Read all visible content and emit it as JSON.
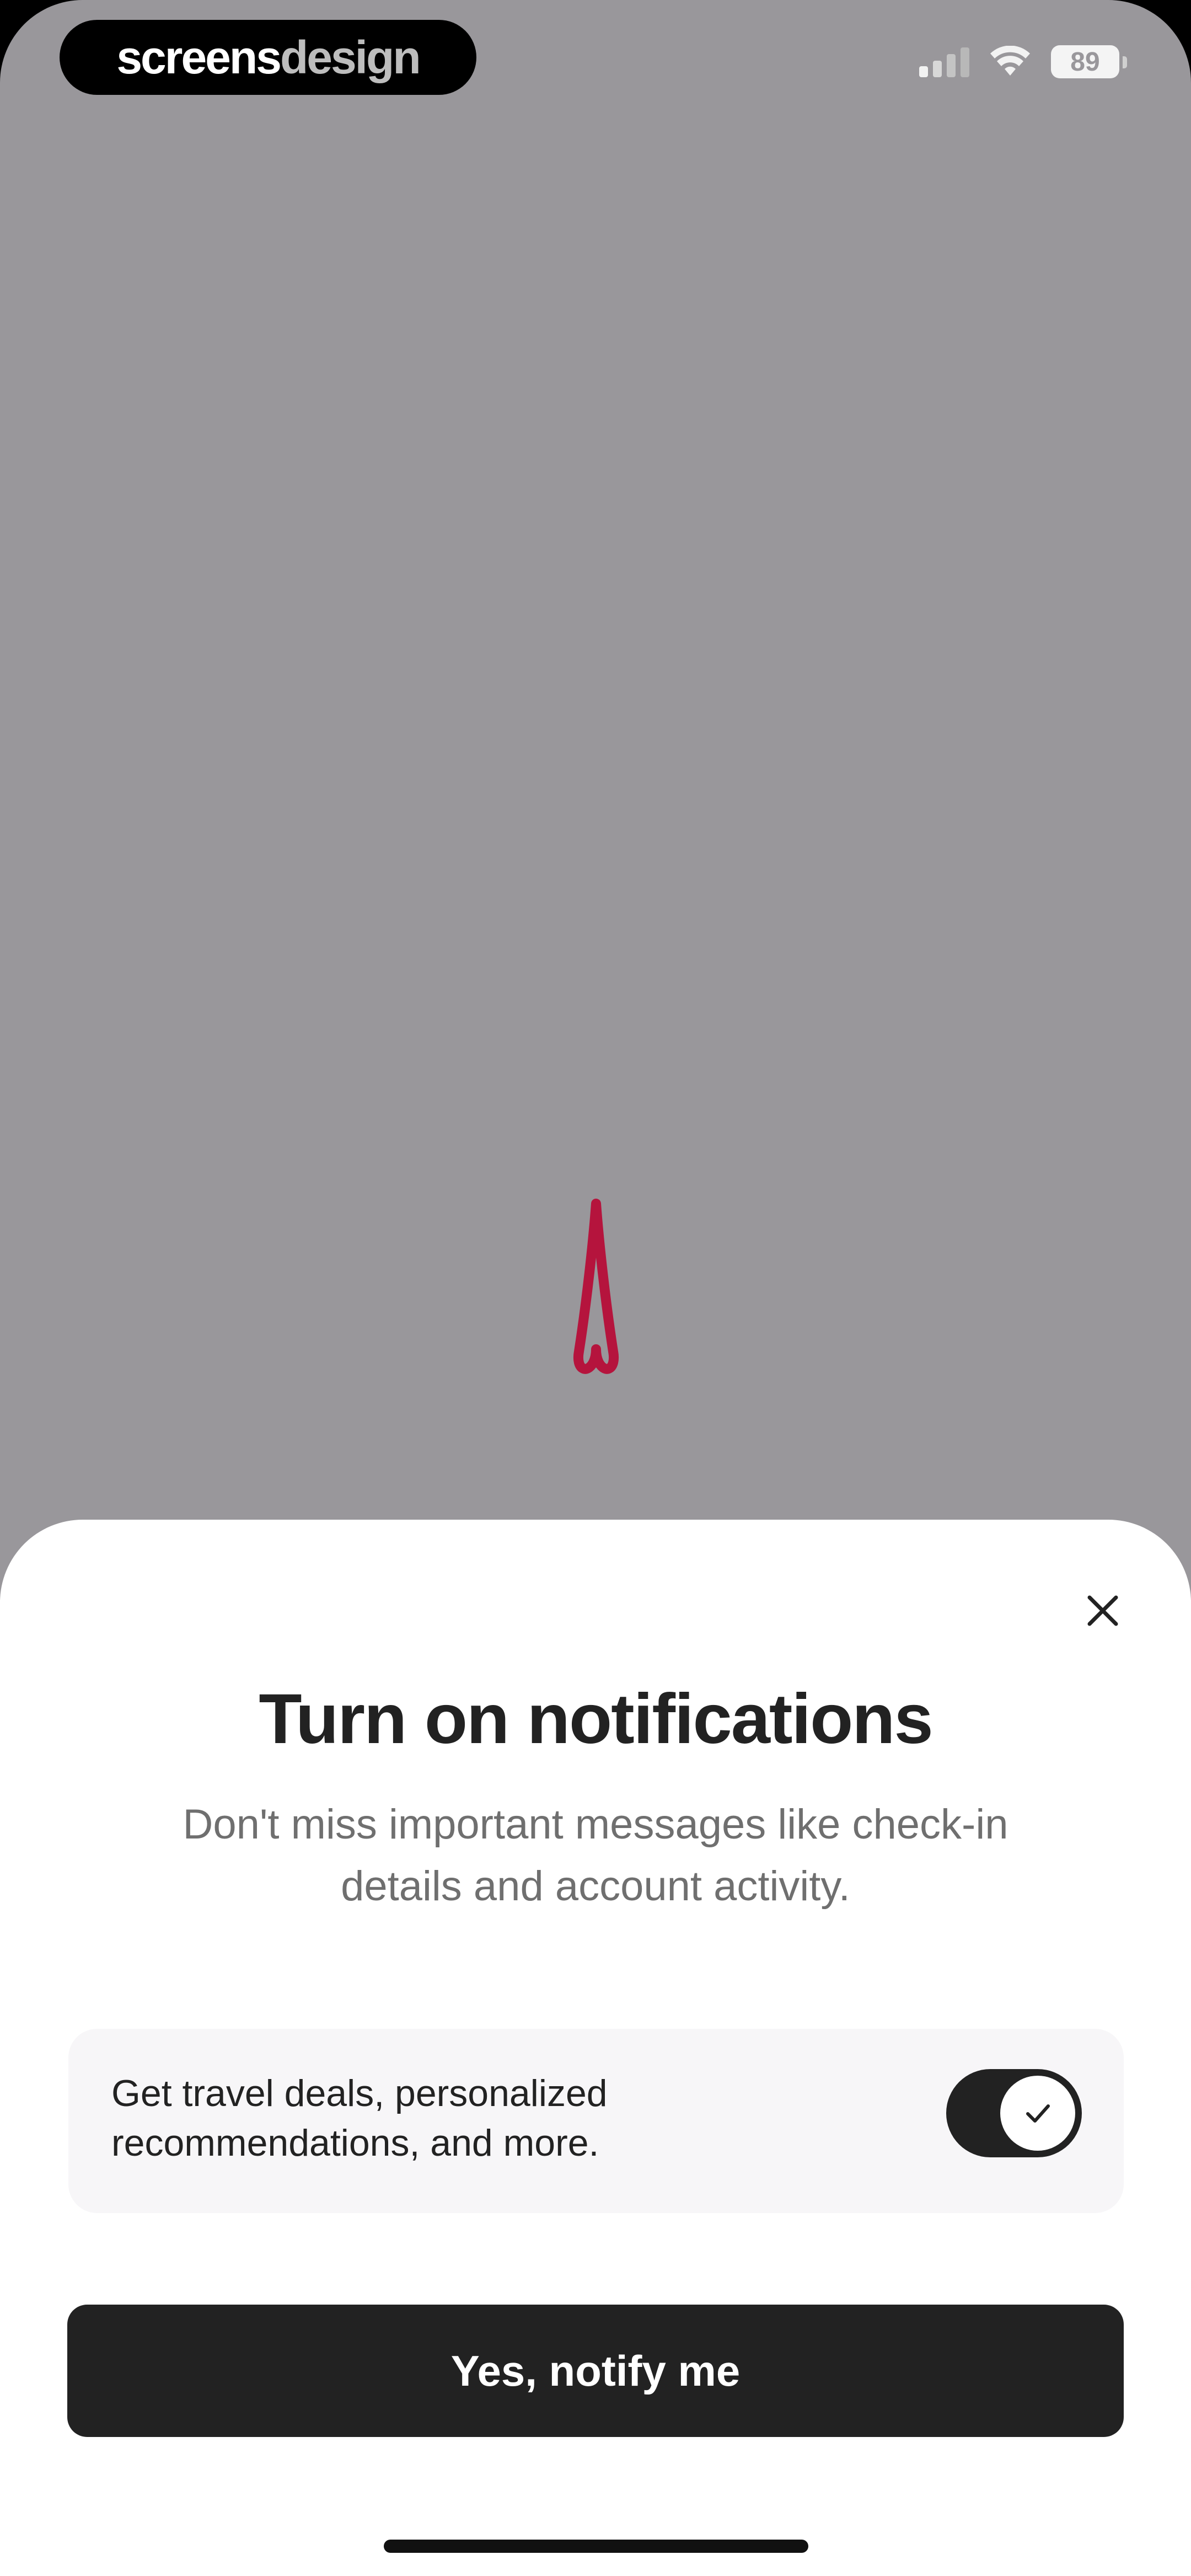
{
  "watermark": {
    "part1": "screens",
    "part2": "design"
  },
  "status_bar": {
    "battery": "89",
    "icons": [
      "cellular-signal-icon",
      "wifi-icon",
      "battery-icon"
    ]
  },
  "background": {
    "loading_icon": "airbnb-logo-loading-icon",
    "accent_color": "#b5143d",
    "dim_color": "#99979b"
  },
  "sheet": {
    "close_icon": "close-icon",
    "title": "Turn on notifications",
    "subtitle": "Don't miss important messages like check-in details and account activity.",
    "option": {
      "label": "Get travel deals, personalized recommendations, and more.",
      "enabled": true,
      "toggle_icon": "checkmark-icon"
    },
    "primary_button": "Yes, notify me"
  }
}
